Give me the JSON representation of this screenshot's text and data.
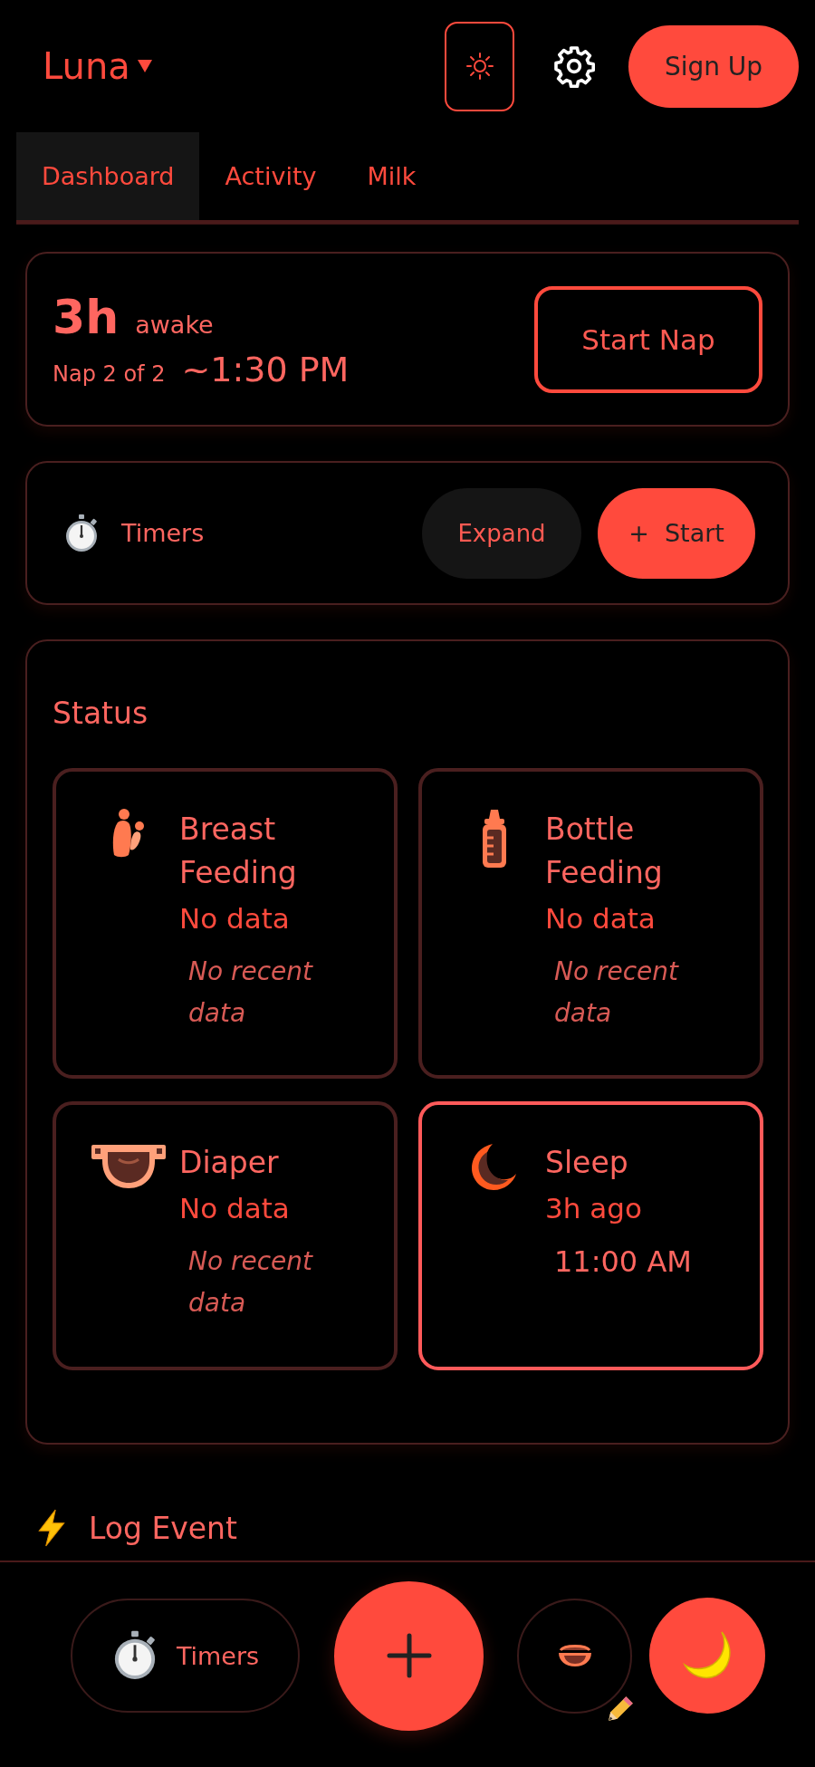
{
  "header": {
    "child_name": "Luna",
    "signup_button": "Sign Up"
  },
  "tabs": [
    {
      "label": "Dashboard",
      "selected": true
    },
    {
      "label": "Activity",
      "selected": false
    },
    {
      "label": "Milk",
      "selected": false
    }
  ],
  "nap_card": {
    "awake_duration": "3h",
    "awake_label": "awake",
    "nap_count": "Nap 2 of 2",
    "nap_time": "~1:30 PM",
    "button": "Start Nap"
  },
  "timers_card": {
    "title": "Timers",
    "expand_button": "Expand",
    "start_button": "+  Start"
  },
  "status": {
    "title": "Status",
    "cards": [
      {
        "kind": "breast",
        "title": "Breast Feeding",
        "value": "No data",
        "detail": "No recent data",
        "active": false
      },
      {
        "kind": "bottle",
        "title": "Bottle Feeding",
        "value": "No data",
        "detail": "No recent data",
        "active": false
      },
      {
        "kind": "diaper",
        "title": "Diaper",
        "value": "No data",
        "detail": "No recent data",
        "active": false
      },
      {
        "kind": "sleep",
        "title": "Sleep",
        "value": "3h ago",
        "detail": "11:00 AM",
        "active": true
      }
    ]
  },
  "log_event": {
    "title": "Log Event"
  },
  "bottom_bar": {
    "timers_button": "Timers"
  }
}
